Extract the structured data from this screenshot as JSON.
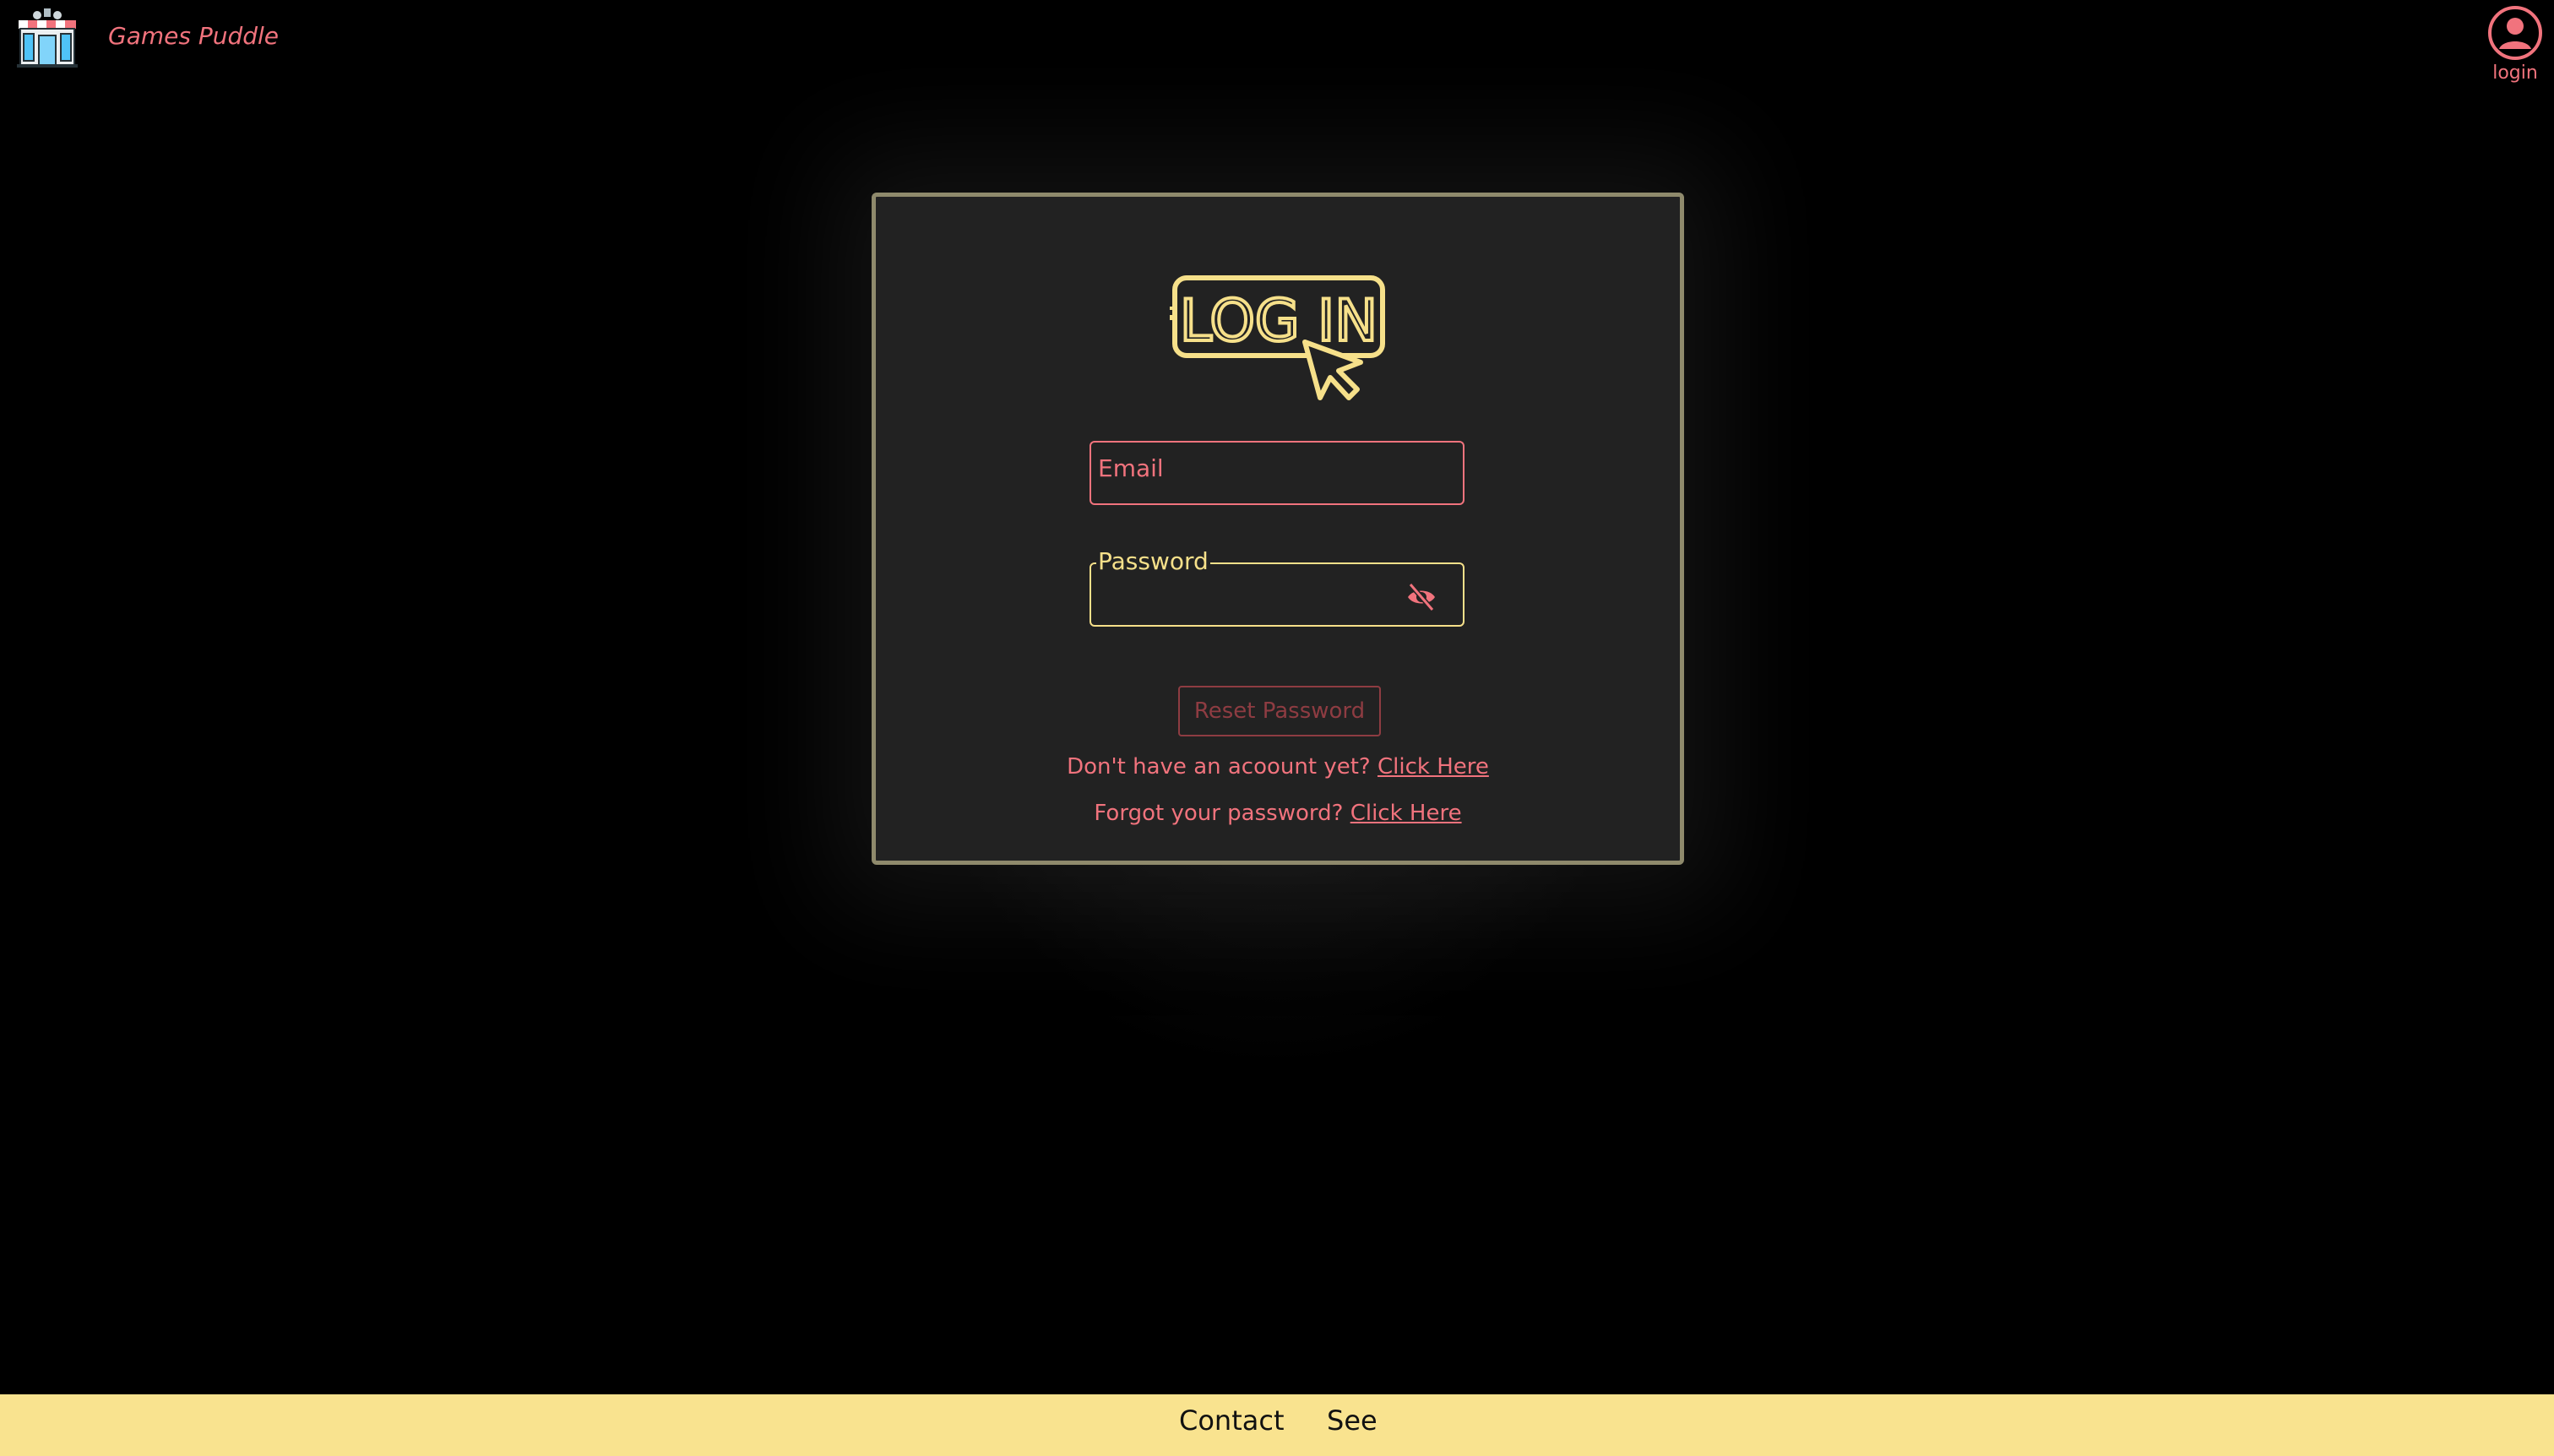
{
  "header": {
    "site_name": "Games Puddle",
    "login_label": "login"
  },
  "card": {
    "logo_text": "LOG IN",
    "email_placeholder": "Email",
    "password_label": "Password",
    "reset_button": "Reset Password",
    "signup_prompt": "Don't have an acoount yet?",
    "signup_link": "Click Here",
    "forgot_prompt": "Forgot your password?",
    "forgot_link": "Click Here"
  },
  "footer": {
    "contact": "Contact",
    "see": "See"
  },
  "colors": {
    "accent": "#f1737d",
    "highlight": "#f6e08a",
    "footer_bg": "#f9e38f",
    "card_bg": "#222222"
  },
  "icons": [
    "storefront-logo-icon",
    "user-circle-icon",
    "login-cursor-logo",
    "eye-slash-icon"
  ]
}
